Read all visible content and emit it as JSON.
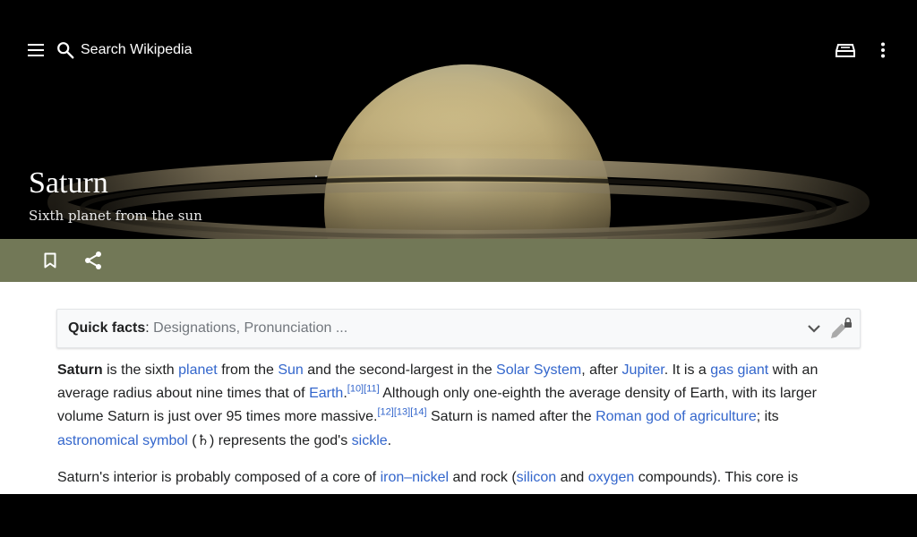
{
  "search": {
    "placeholder": "Search Wikipedia"
  },
  "article": {
    "title": "Saturn",
    "subtitle": "Sixth planet from the sun"
  },
  "icons": {
    "menu": "menu-icon",
    "search": "search-icon",
    "reading_list": "reading-list-icon",
    "overflow": "more-vert-icon",
    "bookmark": "bookmark-icon",
    "share": "share-icon",
    "expand": "chevron-down-icon",
    "edit_locked": "edit-locked-icon"
  },
  "colors": {
    "action_bar": "#727857",
    "link": "#3366cc",
    "progress": "#14866d"
  },
  "quick_facts": {
    "label": "Quick facts",
    "separator": ": ",
    "details": "Designations, Pronunciation ..."
  },
  "paragraph1": {
    "s1_bold": "Saturn",
    "s2": " is the sixth ",
    "l_planet": "planet",
    "s3": " from the ",
    "l_sun": "Sun",
    "s4": " and the second-largest in the ",
    "l_solar": "Solar System",
    "s5": ", after ",
    "l_jupiter": "Jupiter",
    "s6": ". It is a ",
    "l_gas": "gas giant",
    "s7": " with an average radius about nine times that of ",
    "l_earth": "Earth",
    "s8": ".",
    "ref10": "[10]",
    "ref11": "[11]",
    "s9": " Although only one-eighth the average density of Earth, with its larger volume Saturn is just over 95 times more massive.",
    "ref12": "[12]",
    "ref13": "[13]",
    "ref14": "[14]",
    "s10": " Saturn is named after the ",
    "l_roman": "Roman god of agriculture",
    "s11": "; its ",
    "l_symbol": "astronomical symbol",
    "s12": " (",
    "symbol": "♄",
    "s13": ") represents the god's ",
    "l_sickle": "sickle",
    "s14": "."
  },
  "paragraph2": {
    "s1": "Saturn's interior is probably composed of a core of ",
    "l_ironnickel": "iron–nickel",
    "s2": " and rock (",
    "l_silicon": "silicon",
    "s3": " and ",
    "l_oxygen": "oxygen",
    "s4": " compounds). This core is"
  }
}
